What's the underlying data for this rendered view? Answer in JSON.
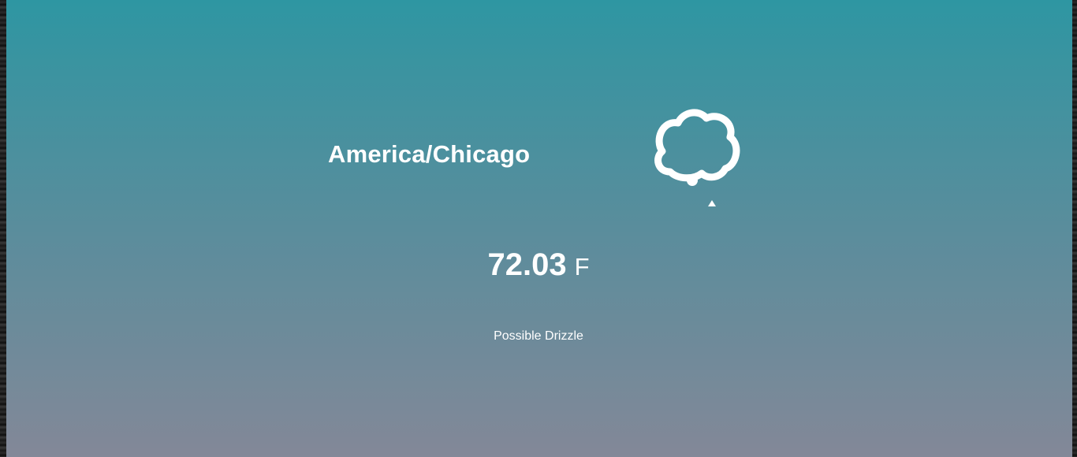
{
  "weather": {
    "timezone": "America/Chicago",
    "temperature": "72.03",
    "unit": "F",
    "summary": "Possible Drizzle",
    "icon": "drizzle-cloud-icon"
  },
  "colors": {
    "gradient_top": "#2e96a2",
    "gradient_bottom": "#838898",
    "text": "#ffffff"
  }
}
